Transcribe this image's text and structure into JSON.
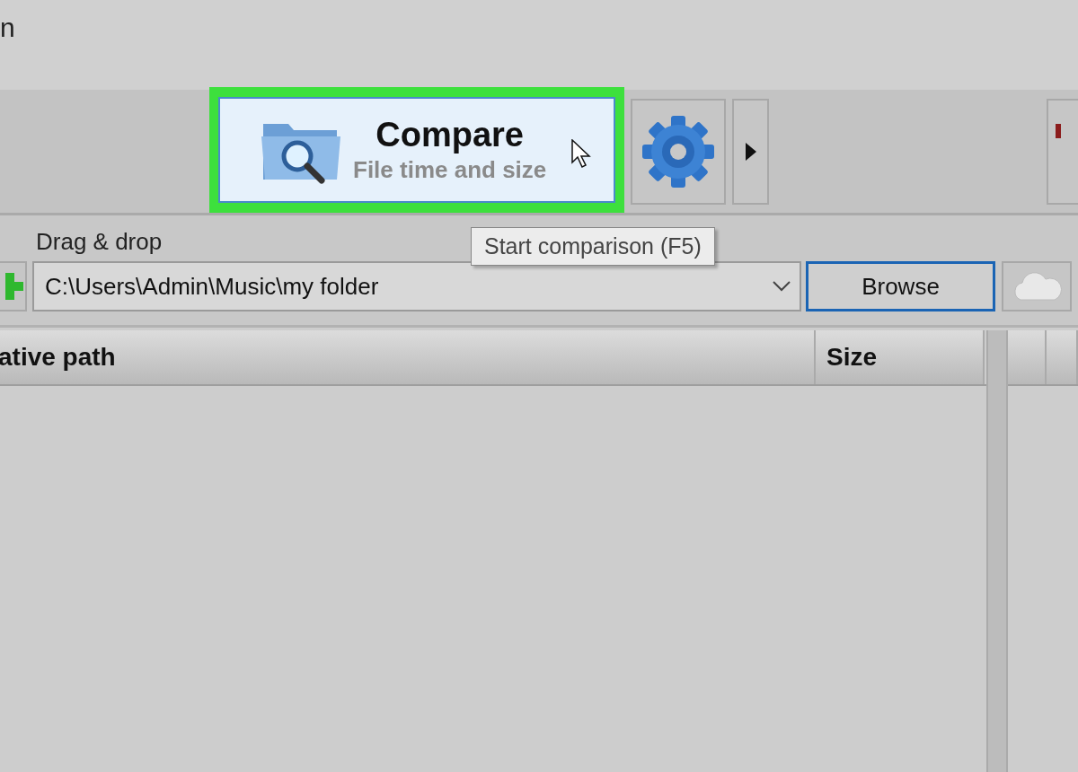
{
  "window": {
    "title_fragment": "n"
  },
  "toolbar": {
    "compare_button": {
      "title": "Compare",
      "subtitle": "File time and size",
      "highlighted": true
    },
    "tooltip": "Start comparison (F5)"
  },
  "folder_pane": {
    "label": "Drag & drop",
    "path": "C:\\Users\\Admin\\Music\\my folder",
    "browse_button": "Browse"
  },
  "table": {
    "columns": [
      {
        "label": "ative path"
      },
      {
        "label": "Size"
      }
    ]
  }
}
